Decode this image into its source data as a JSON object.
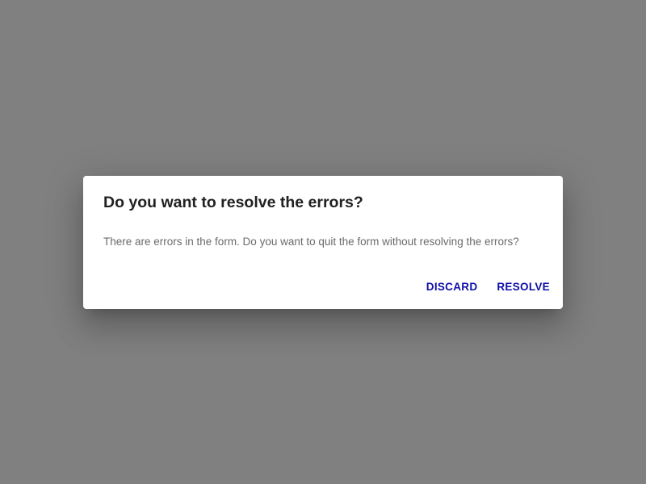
{
  "dialog": {
    "title": "Do you want to resolve the errors?",
    "message": "There are errors in the form. Do you want to quit the form without resolving the errors?",
    "actions": {
      "discard": "DISCARD",
      "resolve": "RESOLVE"
    }
  },
  "colors": {
    "overlay": "#808080",
    "accent": "#0f0fa8"
  }
}
